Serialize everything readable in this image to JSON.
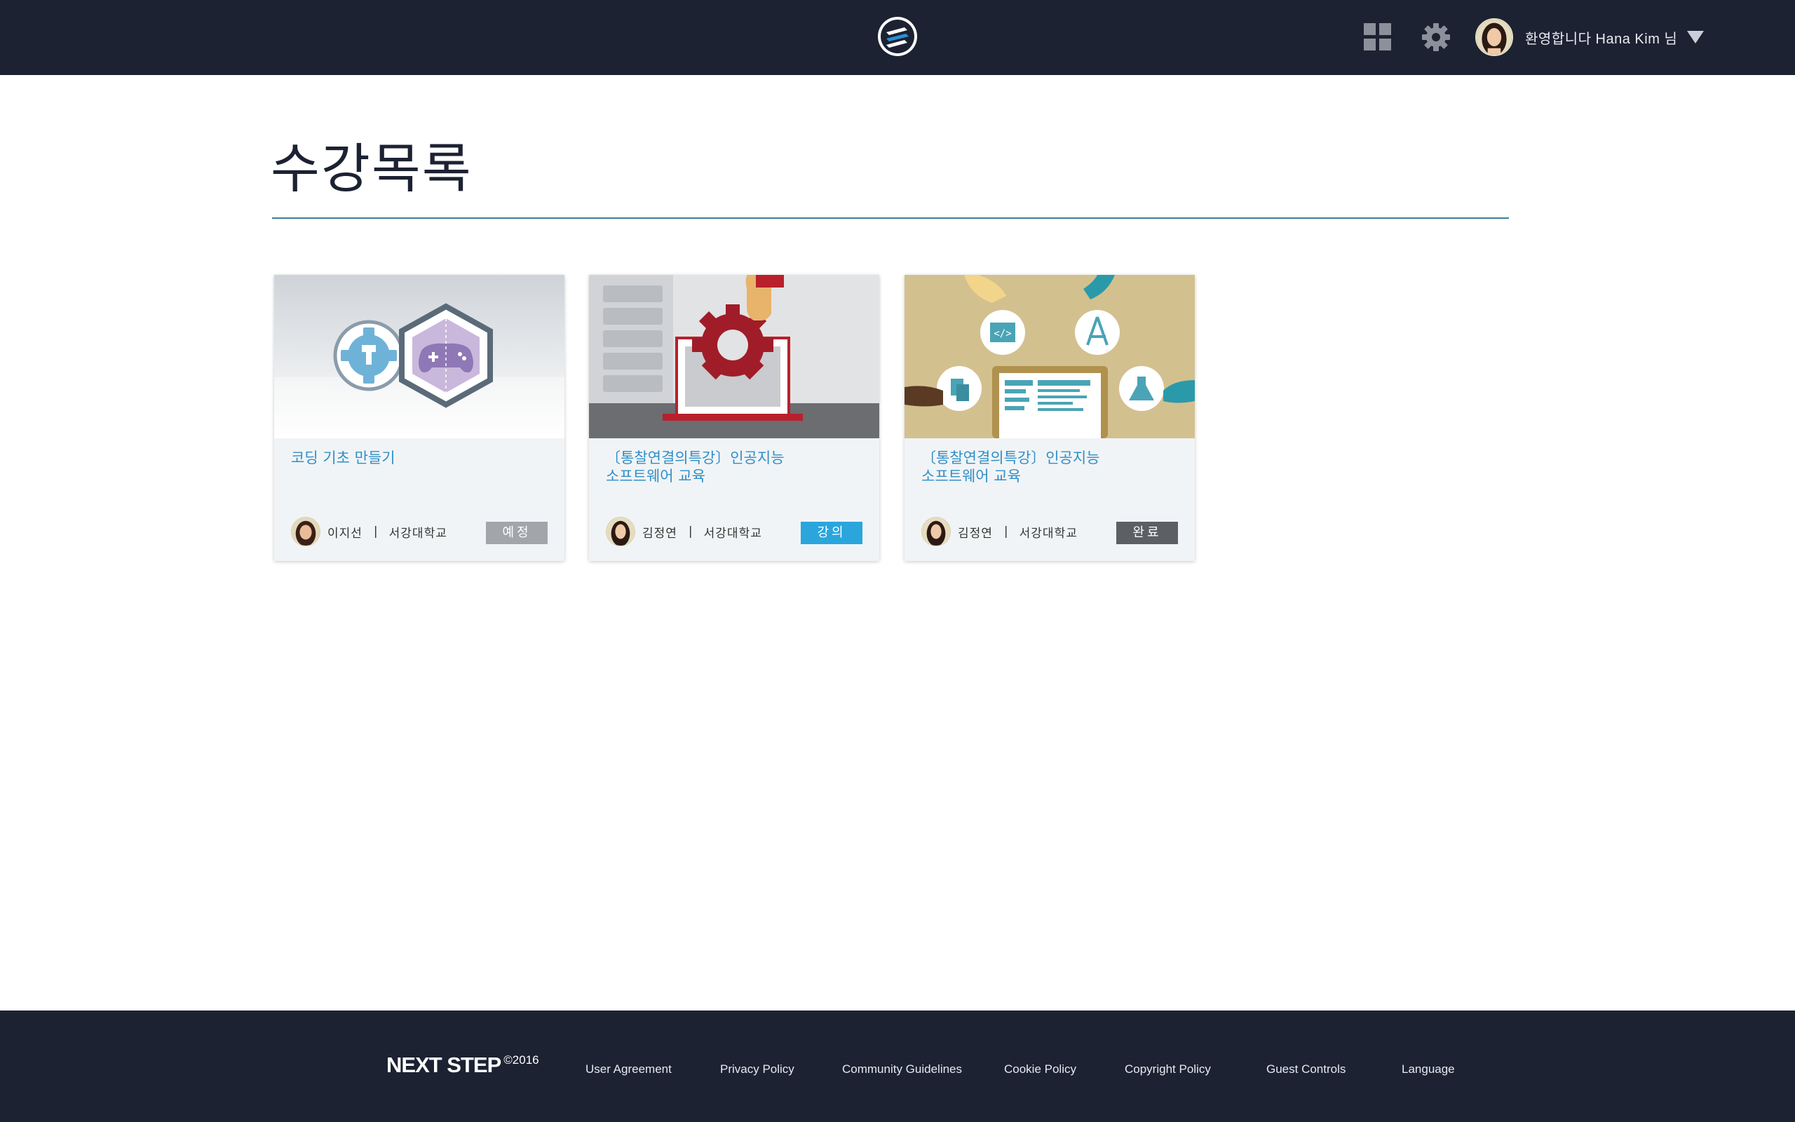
{
  "header": {
    "logo_icon": "next-step-logo-icon",
    "apps_icon": "grid-apps-icon",
    "settings_icon": "gear-icon",
    "welcome_text": "환영합니다 Hana Kim 님",
    "colors": {
      "background": "#1c2232"
    }
  },
  "page": {
    "title": "수강목록"
  },
  "courses": [
    {
      "title": "코딩 기초 만들기",
      "instructor": "이지선",
      "separator": "|",
      "school": "서강대학교",
      "status": "예정",
      "status_color": "#a2a6aa"
    },
    {
      "title": "〔통찰연결의특강〕인공지능\n소프트웨어 교육",
      "instructor": "김정연",
      "separator": "|",
      "school": "서강대학교",
      "status": "강의",
      "status_color": "#2aa6dd"
    },
    {
      "title": "〔통찰연결의특강〕인공지능\n소프트웨어 교육",
      "instructor": "김정연",
      "separator": "|",
      "school": "서강대학교",
      "status": "완료",
      "status_color": "#5c5f63"
    }
  ],
  "footer": {
    "brand": "NEXT STEP",
    "copyright": "©2016",
    "links": [
      "User Agreement",
      "Privacy Policy",
      "Community Guidelines",
      "Cookie Policy",
      "Copyright Policy",
      "Guest Controls",
      "Language"
    ]
  }
}
